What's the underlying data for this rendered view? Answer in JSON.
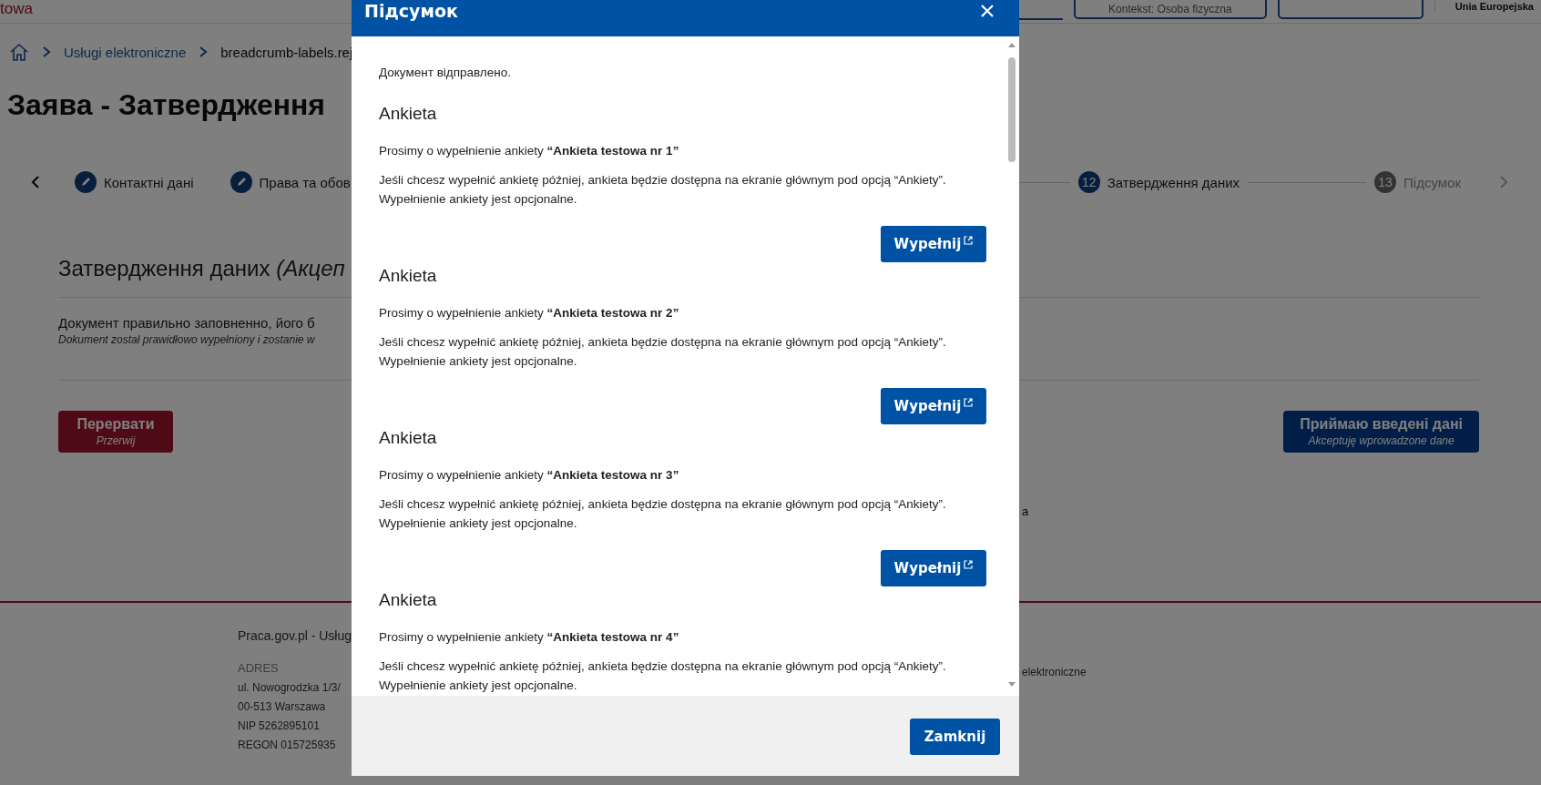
{
  "header": {
    "logo_text": "towa",
    "context_button": "Kontekst: Osoba fizyczna",
    "eu_label": "Unia Europejska"
  },
  "breadcrumb": [
    {
      "label": "Usługi elektroniczne"
    },
    {
      "label": "breadcrumb-labels.rej"
    }
  ],
  "page_title": "Заява - Затвердження",
  "stepper": {
    "steps": [
      {
        "label": "Контактні дані",
        "kind": "edited"
      },
      {
        "label": "Права та обов",
        "kind": "edited"
      },
      {
        "number": "12",
        "label": "Затвердження даних",
        "kind": "current"
      },
      {
        "number": "13",
        "label": "Підсумок",
        "kind": "upcoming"
      }
    ]
  },
  "section": {
    "title": "Затвердження даних",
    "title_note": "(Акцеп",
    "message": "Документ правильно заповненно, його б",
    "message_pl": "Dokument został prawidłowo wypełniony i zostanie w"
  },
  "actions": [
    {
      "label": "Перервати",
      "sublabel": "Przerwij",
      "kind": "danger"
    },
    {
      "label": "Приймаю введені дані",
      "sublabel": "Akceptuję wprowadzone dane",
      "kind": "primary"
    }
  ],
  "fragment": "a",
  "footer": {
    "title": "Praca.gov.pl - Usług",
    "address_label": "ADRES",
    "address_lines": [
      "ul. Nowogrodzka 1/3/",
      "00-513 Warszawa",
      "NIP 5262895101",
      "REGON 015725935"
    ],
    "link": "elektroniczne"
  },
  "modal": {
    "title": "Підсумок",
    "intro": "Документ відправлено.",
    "surveys": [
      {
        "heading": "Ankieta",
        "request": "Prosimy o wypełnienie ankiety **“Ankieta testowa nr 1”**",
        "note": "Jeśli chcesz wypełnić ankietę później, ankieta będzie dostępna na ekranie głównym pod opcją “Ankiety”. Wypełnienie ankiety jest opcjonalne.",
        "button": "Wypełnij"
      },
      {
        "heading": "Ankieta",
        "request": "Prosimy o wypełnienie ankiety **“Ankieta testowa nr 2”**",
        "note": "Jeśli chcesz wypełnić ankietę później, ankieta będzie dostępna na ekranie głównym pod opcją “Ankiety”. Wypełnienie ankiety jest opcjonalne.",
        "button": "Wypełnij"
      },
      {
        "heading": "Ankieta",
        "request": "Prosimy o wypełnienie ankiety **“Ankieta testowa nr 3”**",
        "note": "Jeśli chcesz wypełnić ankietę później, ankieta będzie dostępna na ekranie głównym pod opcją “Ankiety”. Wypełnienie ankiety jest opcjonalne.",
        "button": "Wypełnij"
      },
      {
        "heading": "Ankieta",
        "request": "Prosimy o wypełnienie ankiety **“Ankieta testowa nr 4”**",
        "note": "Jeśli chcesz wypełnić ankietę później, ankieta będzie dostępna na ekranie głównym pod opcją “Ankiety”. Wypełnienie ankiety jest opcjonalne."
      }
    ],
    "close_button": "Zamknij"
  }
}
